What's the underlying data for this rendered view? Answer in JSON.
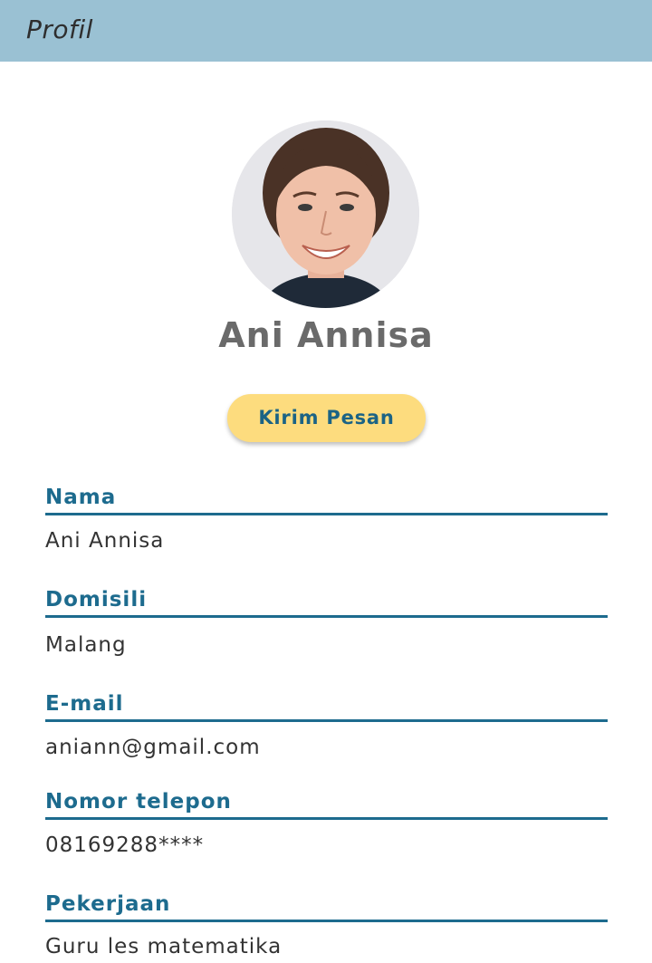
{
  "header": {
    "title": "Profil"
  },
  "profile": {
    "avatar_icon": "profile-photo",
    "name": "Ani Annisa",
    "message_button_label": "Kirim Pesan"
  },
  "fields": [
    {
      "label": "Nama",
      "value": "Ani Annisa"
    },
    {
      "label": "Domisili",
      "value": "Malang"
    },
    {
      "label": "E-mail",
      "value": "aniann@gmail.com"
    },
    {
      "label": "Nomor telepon",
      "value": "08169288****"
    },
    {
      "label": "Pekerjaan",
      "value": "Guru les matematika"
    }
  ],
  "colors": {
    "header_bg": "#9ac1d3",
    "accent": "#1d6b8e",
    "button_bg": "#fddc7e"
  }
}
